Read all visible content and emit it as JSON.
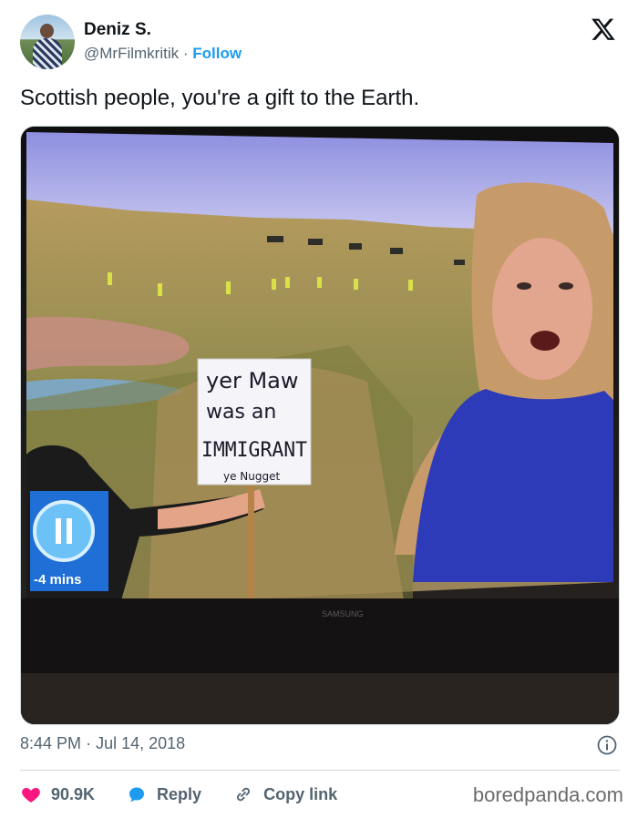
{
  "author": {
    "name": "Deniz S.",
    "handle": "@MrFilmkritik",
    "separator": "·",
    "follow_label": "Follow"
  },
  "tweet": {
    "text": "Scottish people, you're a gift to the Earth.",
    "time": "8:44 PM",
    "date": "Jul 14, 2018",
    "date_separator": "·"
  },
  "media": {
    "sign_lines": [
      "yer Maw",
      "was an",
      "IMMIGRANT",
      "ye Nugget"
    ],
    "overlay_time": "-4 mins",
    "tv_brand": "SAMSUNG",
    "accent_color": "#1e6fd9"
  },
  "actions": {
    "like_count": "90.9K",
    "reply_label": "Reply",
    "copy_link_label": "Copy link"
  },
  "colors": {
    "brand_blue": "#1d9bf0",
    "like_red": "#f91880",
    "muted": "#536471"
  },
  "watermark": "boredpanda.com"
}
